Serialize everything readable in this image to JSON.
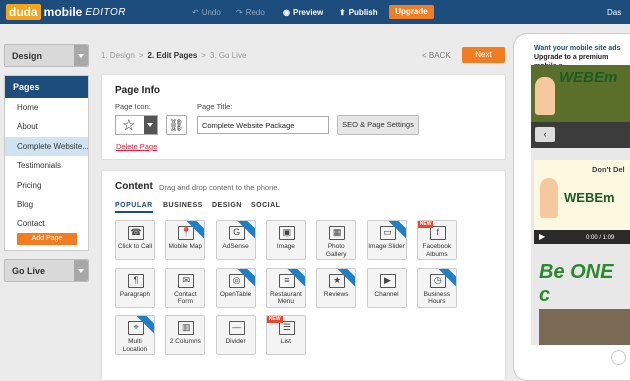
{
  "topbar": {
    "logo_duda": "duda",
    "logo_mobile": "mobile",
    "logo_editor": "EDITOR",
    "undo": "Undo",
    "redo": "Redo",
    "preview": "Preview",
    "publish": "Publish",
    "upgrade": "Upgrade",
    "user": "Das"
  },
  "sidebar": {
    "design": "Design",
    "pages_title": "Pages",
    "pages": [
      "Home",
      "About",
      "Complete Website...",
      "Testimonials",
      "Pricing",
      "Blog",
      "Contact"
    ],
    "add_page": "Add Page",
    "go_live": "Go Live"
  },
  "steps": {
    "s1": "1. Design",
    "s2": "2. Edit Pages",
    "s3": "3. Go Live",
    "sep": ">",
    "back": "< BACK",
    "next": "Next"
  },
  "page_info": {
    "title": "Page Info",
    "icon_label": "Page Icon:",
    "title_label": "Page Title:",
    "title_value": "Complete Website Package",
    "seo_button": "SEO & Page Settings",
    "delete": "Delete Page"
  },
  "content": {
    "title": "Content",
    "hint": "Drag and drop content to the phone.",
    "tabs": [
      "POPULAR",
      "BUSINESS",
      "DESIGN",
      "SOCIAL"
    ],
    "tiles": [
      {
        "label": "Click to Call"
      },
      {
        "label": "Mobile Map"
      },
      {
        "label": "AdSense"
      },
      {
        "label": "Image"
      },
      {
        "label": "Photo Gallery"
      },
      {
        "label": "Image Slider"
      },
      {
        "label": "Facebook Albums"
      },
      {
        "label": "Paragraph"
      },
      {
        "label": "Contact Form"
      },
      {
        "label": "OpenTable"
      },
      {
        "label": "Restaurant Menu"
      },
      {
        "label": "Reviews"
      },
      {
        "label": "Channel"
      },
      {
        "label": "Business Hours"
      },
      {
        "label": "Multi Location"
      },
      {
        "label": "2 Columns"
      },
      {
        "label": "Divider"
      },
      {
        "label": "List"
      }
    ],
    "new_tag": "NEW"
  },
  "phone": {
    "ad_line1": "Want your mobile site ads",
    "ad_line2": "Upgrade to a premium mobile s",
    "brand": "WEBEm",
    "dont": "Don't Del",
    "video_brand": "WEBEm",
    "video_time": "0:00 / 1:09",
    "be_one": "Be ONE c"
  },
  "colors": {
    "topbar": "#1d4d7c",
    "accent": "#f07d22",
    "selected_page": "#cfe3f2"
  }
}
